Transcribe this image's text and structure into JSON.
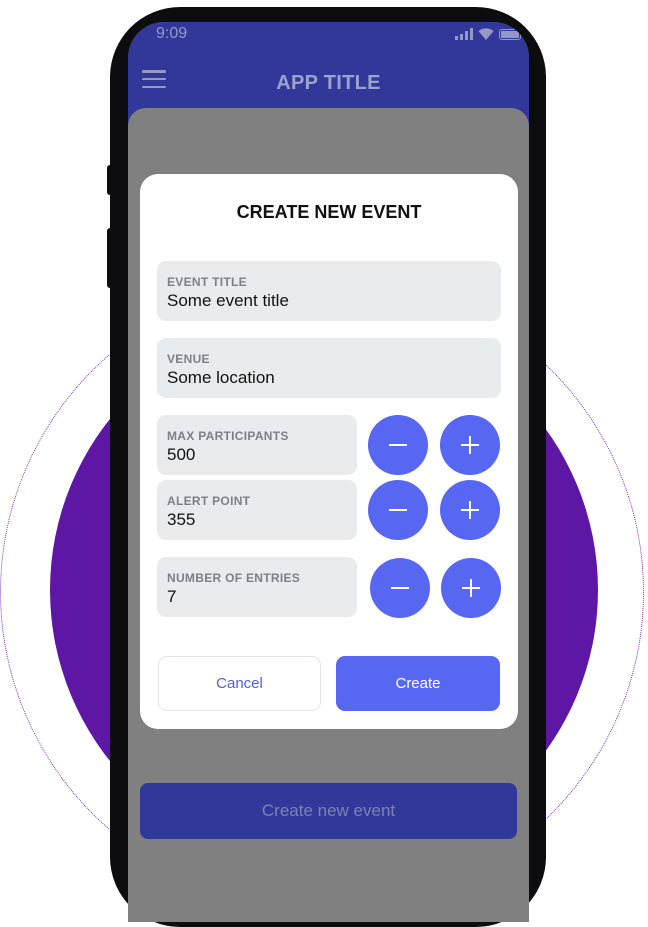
{
  "status_bar": {
    "time": "9:09"
  },
  "app_bar": {
    "title": "APP TITLE"
  },
  "dialog": {
    "title": "CREATE NEW EVENT",
    "fields": {
      "event_title": {
        "label": "EVENT TITLE",
        "value": "Some event title"
      },
      "venue": {
        "label": "VENUE",
        "value": "Some location"
      },
      "max_participants": {
        "label": "MAX PARTICIPANTS",
        "value": "500"
      },
      "alert_point": {
        "label": "ALERT POINT",
        "value": "355"
      },
      "number_of_entries": {
        "label": "NUMBER OF ENTRIES",
        "value": "7"
      }
    },
    "cancel_label": "Cancel",
    "create_label": "Create"
  },
  "bottom_button": {
    "label": "Create new event"
  },
  "colors": {
    "app_bar": "#32389a",
    "accent": "#5867f1",
    "field_bg": "#e9ecef",
    "decor_disc": "#5e16a4"
  }
}
